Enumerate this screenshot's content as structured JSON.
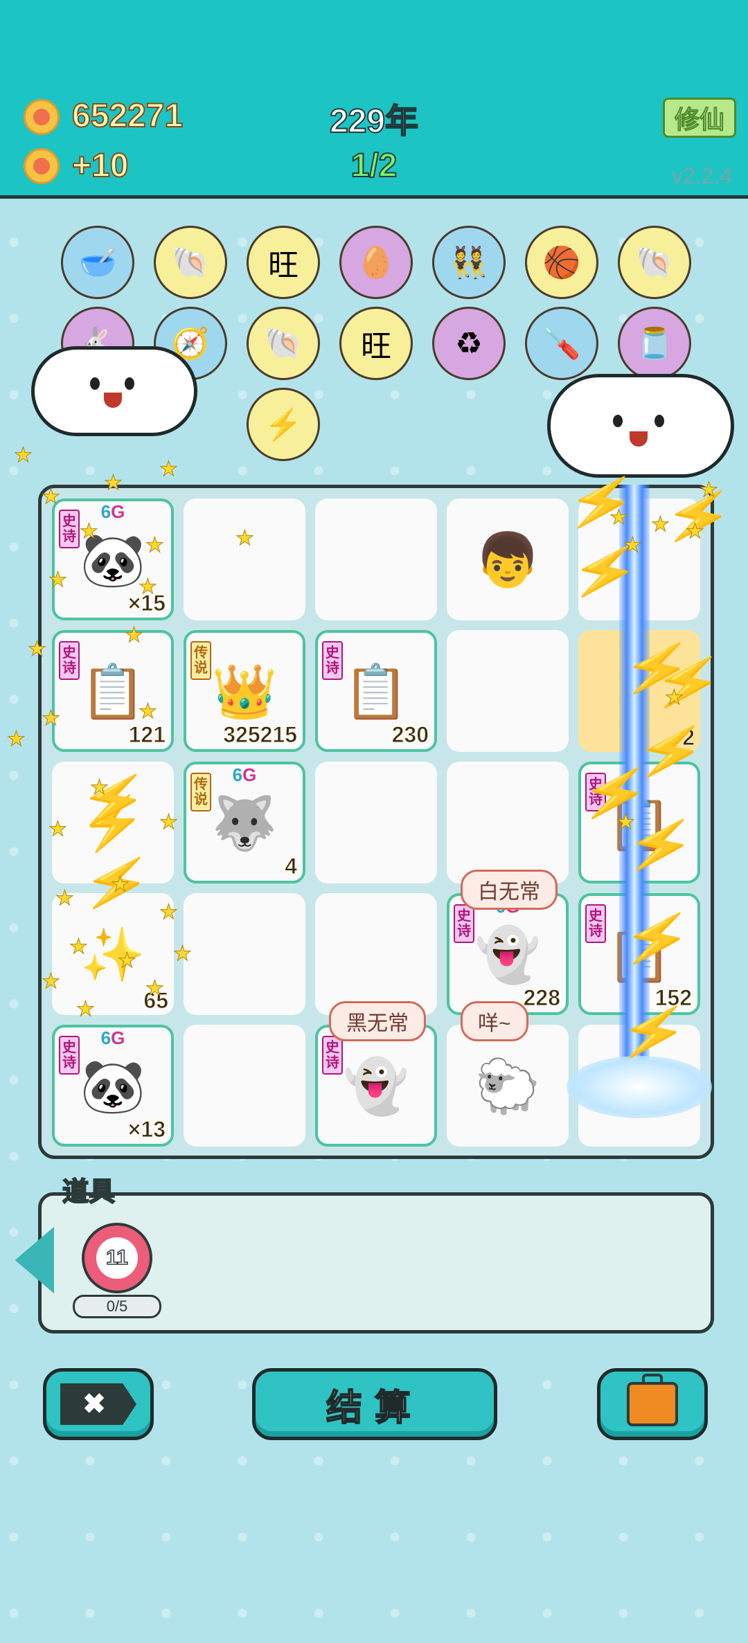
{
  "header": {
    "coins": "652271",
    "income": "+10",
    "year": "229年",
    "progress": "1/2",
    "xiuxian_label": "修仙",
    "version": "v2.2.4"
  },
  "bubbles": [
    {
      "icon": "dog-bowl-icon",
      "glyph": "🥣",
      "color": "blue"
    },
    {
      "icon": "shell-icon",
      "glyph": "🐚",
      "color": "yellow"
    },
    {
      "icon": "wang-text-icon",
      "glyph": "旺",
      "color": "yellow"
    },
    {
      "icon": "egg-icon",
      "glyph": "🥚",
      "color": "purple"
    },
    {
      "icon": "twins-icon",
      "glyph": "👯",
      "color": "blue"
    },
    {
      "icon": "basketball-icon",
      "glyph": "🏀",
      "color": "yellow"
    },
    {
      "icon": "shell-icon",
      "glyph": "🐚",
      "color": "yellow"
    },
    {
      "icon": "rabbit-icon",
      "glyph": "🐇",
      "color": "purple"
    },
    {
      "icon": "compass-icon",
      "glyph": "🧭",
      "color": "blue"
    },
    {
      "icon": "shell-icon",
      "glyph": "🐚",
      "color": "yellow"
    },
    {
      "icon": "wang-text-icon",
      "glyph": "旺",
      "color": "yellow"
    },
    {
      "icon": "recycle-icon",
      "glyph": "♻",
      "color": "purple"
    },
    {
      "icon": "screwdriver-icon",
      "glyph": "🪛",
      "color": "blue"
    },
    {
      "icon": "milk-jar-icon",
      "glyph": "🫙",
      "color": "purple"
    },
    {
      "icon": "lightning-icon",
      "glyph": "⚡",
      "color": "yellow"
    }
  ],
  "board": {
    "cells": [
      {
        "name": "panda-x-cell",
        "rarity": "史诗",
        "sixg": true,
        "icon": "panda-icon",
        "glyph": "🐼",
        "count": "×15"
      },
      {
        "name": "empty-cell"
      },
      {
        "name": "empty-cell"
      },
      {
        "name": "boy-face-cell",
        "icon": "boy-face-icon",
        "glyph": "👦"
      },
      {
        "name": "empty-cell"
      },
      {
        "name": "ctrl-c-cell",
        "rarity": "史诗",
        "icon": "copy-paste-icon",
        "glyph": "📋",
        "count": "121"
      },
      {
        "name": "king-cell",
        "rarity": "传说",
        "icon": "crowned-man-icon",
        "glyph": "👑",
        "count": "325215"
      },
      {
        "name": "ctrl-v-cell",
        "rarity": "史诗",
        "icon": "copy-paste-icon",
        "glyph": "📋",
        "count": "230"
      },
      {
        "name": "empty-cell"
      },
      {
        "name": "highlighted-cell",
        "count": "2",
        "highlight": true
      },
      {
        "name": "lightning-cell",
        "icon": "lightning-icon",
        "glyph": "⚡"
      },
      {
        "name": "husky-cell",
        "rarity": "传说",
        "sixg": true,
        "icon": "husky-icon",
        "glyph": "🐺",
        "count": "4"
      },
      {
        "name": "empty-cell"
      },
      {
        "name": "empty-cell"
      },
      {
        "name": "copy-cell",
        "rarity": "史诗",
        "icon": "copy-paste-icon",
        "glyph": "📋"
      },
      {
        "name": "star-burst-cell",
        "icon": "stars-icon",
        "glyph": "✨",
        "count": "65"
      },
      {
        "name": "empty-cell"
      },
      {
        "name": "empty-cell"
      },
      {
        "name": "bai-wuchang-cell",
        "rarity": "史诗",
        "sixg": true,
        "icon": "ghost-icon",
        "glyph": "👻",
        "count": "228",
        "speech": "白无常"
      },
      {
        "name": "copy-cell-2",
        "rarity": "史诗",
        "icon": "copy-paste-icon",
        "glyph": "📋",
        "count": "152"
      },
      {
        "name": "panda-cell",
        "rarity": "史诗",
        "sixg": true,
        "icon": "panda-icon",
        "glyph": "🐼",
        "count": "×13"
      },
      {
        "name": "empty-cell"
      },
      {
        "name": "hei-wuchang-cell",
        "rarity": "史诗",
        "icon": "ghost-pair-icon",
        "glyph": "👻",
        "speech": "黑无常"
      },
      {
        "name": "sheep-cell",
        "icon": "sheep-icon",
        "glyph": "🐑",
        "speech": "咩~"
      },
      {
        "name": "beam-cell"
      }
    ],
    "sixg_label_six": "6",
    "sixg_label_g": "G"
  },
  "tools": {
    "label": "道具",
    "item_value": "11",
    "item_count": "0/5"
  },
  "buttons": {
    "cancel_icon": "✖",
    "settle_label": "结算",
    "bag_icon": "briefcase-icon"
  },
  "colors": {
    "header": "#1cc4c4",
    "background": "#b3e3ea",
    "accent": "#2fc3c3",
    "epic": "#b0157a",
    "legend": "#b06a10"
  }
}
